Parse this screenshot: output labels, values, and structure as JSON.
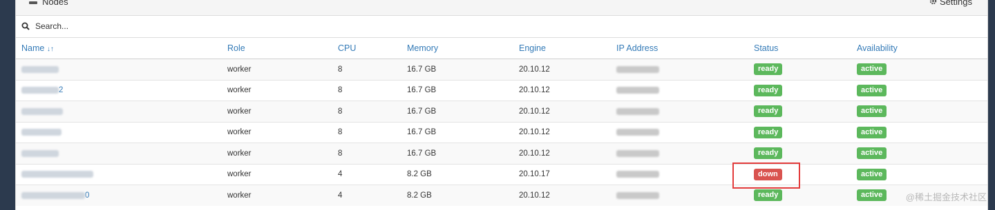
{
  "header": {
    "title": "Nodes",
    "settings_label": "Settings"
  },
  "search": {
    "placeholder": "Search..."
  },
  "table": {
    "columns": [
      "Name",
      "Role",
      "CPU",
      "Memory",
      "Engine",
      "IP Address",
      "Status",
      "Availability"
    ],
    "rows": [
      {
        "name_suffix": "",
        "role": "worker",
        "cpu": "8",
        "memory": "16.7 GB",
        "engine": "20.10.12",
        "status": "ready",
        "availability": "active"
      },
      {
        "name_suffix": "2",
        "role": "worker",
        "cpu": "8",
        "memory": "16.7 GB",
        "engine": "20.10.12",
        "status": "ready",
        "availability": "active"
      },
      {
        "name_suffix": "",
        "role": "worker",
        "cpu": "8",
        "memory": "16.7 GB",
        "engine": "20.10.12",
        "status": "ready",
        "availability": "active"
      },
      {
        "name_suffix": "",
        "role": "worker",
        "cpu": "8",
        "memory": "16.7 GB",
        "engine": "20.10.12",
        "status": "ready",
        "availability": "active"
      },
      {
        "name_suffix": "",
        "role": "worker",
        "cpu": "8",
        "memory": "16.7 GB",
        "engine": "20.10.12",
        "status": "ready",
        "availability": "active"
      },
      {
        "name_suffix": "",
        "role": "worker",
        "cpu": "4",
        "memory": "8.2 GB",
        "engine": "20.10.17",
        "status": "down",
        "availability": "active"
      },
      {
        "name_suffix": "0",
        "role": "worker",
        "cpu": "4",
        "memory": "8.2 GB",
        "engine": "20.10.12",
        "status": "ready",
        "availability": "active"
      }
    ]
  },
  "watermark": "@稀土掘金技术社区",
  "colors": {
    "link": "#337ab7",
    "ready": "#5cb85c",
    "down": "#d9534f",
    "highlight": "#e33b3b"
  }
}
